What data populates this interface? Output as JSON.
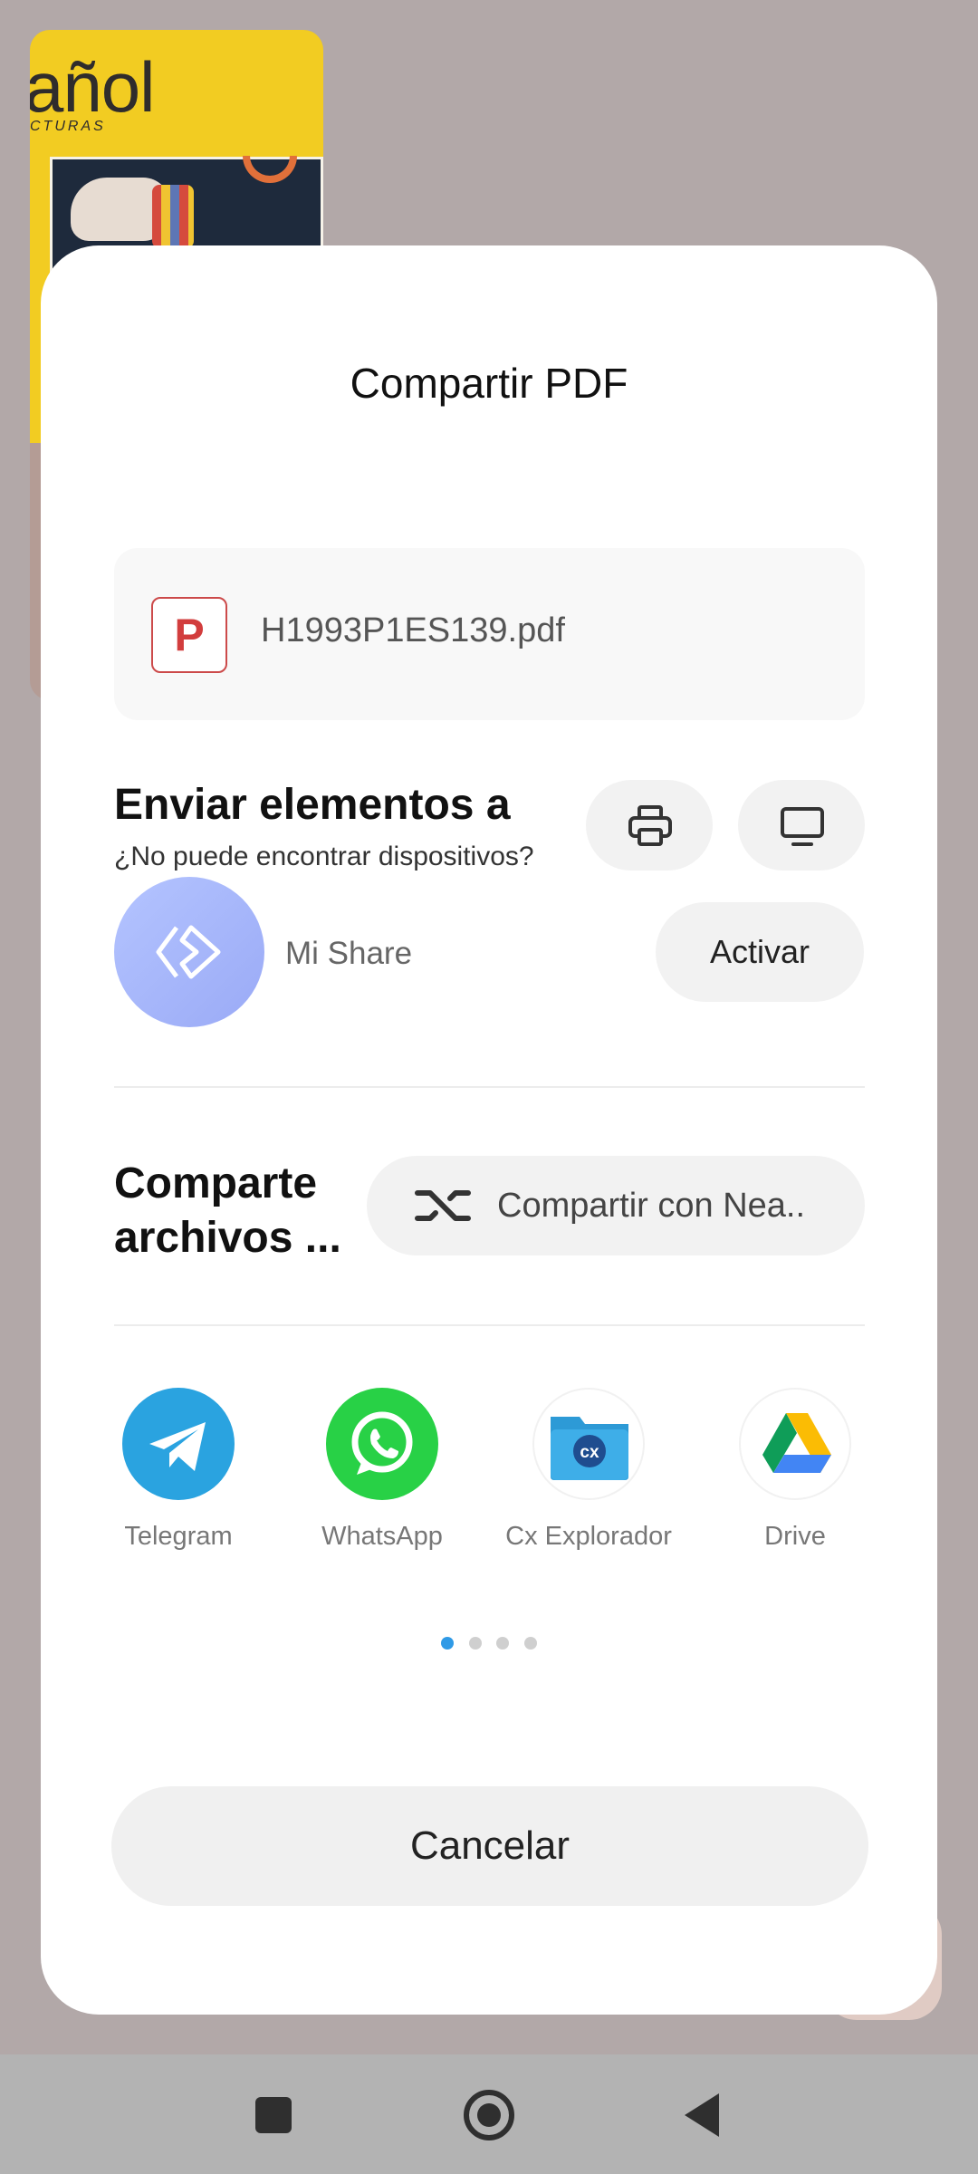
{
  "background": {
    "book_cover_title": "añol",
    "book_cover_subtitle": "CTURAS"
  },
  "sheet": {
    "title": "Compartir PDF",
    "file": {
      "icon_letter": "P",
      "name": "H1993P1ES139.pdf"
    },
    "send_section": {
      "heading": "Enviar elementos a",
      "subtitle": "¿No puede encontrar dispositivos?",
      "print_icon": "printer-icon",
      "screen_icon": "monitor-icon"
    },
    "mishare": {
      "label": "Mi Share",
      "activate_label": "Activar"
    },
    "share_section": {
      "heading": "Comparte archivos ...",
      "nearby_label": "Compartir con Nea.."
    },
    "apps": [
      {
        "label": "Telegram",
        "icon": "telegram-icon",
        "color": "#2aa3e0"
      },
      {
        "label": "WhatsApp",
        "icon": "whatsapp-icon",
        "color": "#28d146"
      },
      {
        "label": "Cx Explorador",
        "icon": "cx-explorer-icon",
        "color": "#2d9ad6"
      },
      {
        "label": "Drive",
        "icon": "google-drive-icon",
        "color": "#ffffff"
      }
    ],
    "pager": {
      "pages": 4,
      "active": 0
    },
    "cancel_label": "Cancelar"
  },
  "colors": {
    "accent": "#2f9ae6",
    "pdf_red": "#d23d3d"
  }
}
